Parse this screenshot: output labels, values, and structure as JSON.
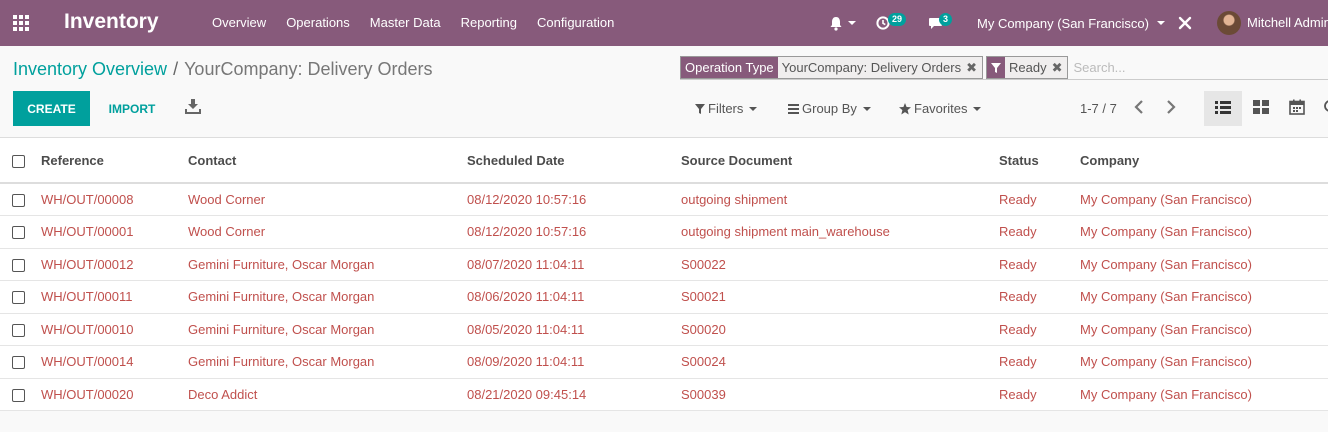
{
  "navbar": {
    "app_title": "Inventory",
    "menu": [
      "Overview",
      "Operations",
      "Master Data",
      "Reporting",
      "Configuration"
    ],
    "activity_count": "29",
    "messages_count": "3",
    "company": "My Company (San Francisco)",
    "user": "Mitchell Admin",
    "color": "#875a7b"
  },
  "breadcrumb": {
    "parent": "Inventory Overview",
    "separator": "/",
    "current": "YourCompany: Delivery Orders"
  },
  "search": {
    "facets": [
      {
        "label": "Operation Type",
        "value": "YourCompany: Delivery Orders"
      },
      {
        "icon": "filter-icon",
        "value": "Ready"
      }
    ],
    "placeholder": "Search..."
  },
  "buttons": {
    "create": "CREATE",
    "import": "IMPORT"
  },
  "dropdowns": {
    "filters": "Filters",
    "group_by": "Group By",
    "favorites": "Favorites"
  },
  "pager": {
    "value": "1-7 / 7"
  },
  "table": {
    "columns": [
      "Reference",
      "Contact",
      "Scheduled Date",
      "Source Document",
      "Status",
      "Company"
    ],
    "rows": [
      {
        "reference": "WH/OUT/00008",
        "contact": "Wood Corner",
        "date": "08/12/2020 10:57:16",
        "source": "outgoing shipment",
        "status": "Ready",
        "company": "My Company (San Francisco)"
      },
      {
        "reference": "WH/OUT/00001",
        "contact": "Wood Corner",
        "date": "08/12/2020 10:57:16",
        "source": "outgoing shipment main_warehouse",
        "status": "Ready",
        "company": "My Company (San Francisco)"
      },
      {
        "reference": "WH/OUT/00012",
        "contact": "Gemini Furniture, Oscar Morgan",
        "date": "08/07/2020 11:04:11",
        "source": "S00022",
        "status": "Ready",
        "company": "My Company (San Francisco)"
      },
      {
        "reference": "WH/OUT/00011",
        "contact": "Gemini Furniture, Oscar Morgan",
        "date": "08/06/2020 11:04:11",
        "source": "S00021",
        "status": "Ready",
        "company": "My Company (San Francisco)"
      },
      {
        "reference": "WH/OUT/00010",
        "contact": "Gemini Furniture, Oscar Morgan",
        "date": "08/05/2020 11:04:11",
        "source": "S00020",
        "status": "Ready",
        "company": "My Company (San Francisco)"
      },
      {
        "reference": "WH/OUT/00014",
        "contact": "Gemini Furniture, Oscar Morgan",
        "date": "08/09/2020 11:04:11",
        "source": "S00024",
        "status": "Ready",
        "company": "My Company (San Francisco)"
      },
      {
        "reference": "WH/OUT/00020",
        "contact": "Deco Addict",
        "date": "08/21/2020 09:45:14",
        "source": "S00039",
        "status": "Ready",
        "company": "My Company (San Francisco)"
      }
    ]
  },
  "colors": {
    "accent": "#00a09d",
    "row_text": "#c0504d"
  }
}
